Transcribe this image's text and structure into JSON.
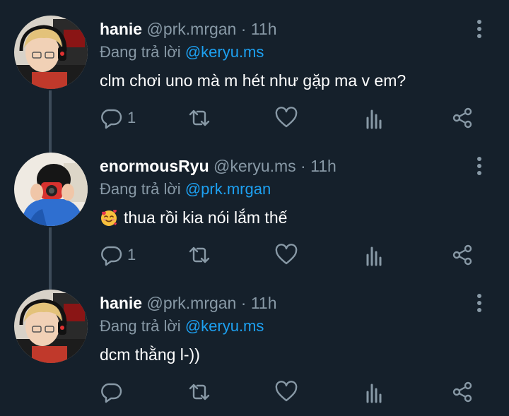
{
  "tweets": [
    {
      "name": "hanie",
      "handle": "@prk.mrgan",
      "dot": " · ",
      "time": "11h",
      "reply_prefix": "Đang trả lời ",
      "reply_to": "@keryu.ms",
      "text": "clm chơi uno mà m hét như gặp ma v em?",
      "reply_count": "1"
    },
    {
      "name": "enormousRyu",
      "handle": "@keryu.ms",
      "dot": " · ",
      "time": "11h",
      "reply_prefix": "Đang trả lời ",
      "reply_to": "@prk.mrgan",
      "text": "thua rồi kia nói lắm thế",
      "reply_count": "1"
    },
    {
      "name": "hanie",
      "handle": "@prk.mrgan",
      "dot": " · ",
      "time": "11h",
      "reply_prefix": "Đang trả lời ",
      "reply_to": "@keryu.ms",
      "text": "dcm thằng l-))",
      "reply_count": ""
    }
  ],
  "icons": {
    "more": "more-vertical-icon",
    "reply": "reply-bubble-icon",
    "retweet": "retweet-icon",
    "like": "heart-icon",
    "analytics": "analytics-icon",
    "share": "share-icon",
    "emoji": "smiling-face-with-hearts-emoji"
  },
  "colors": {
    "background": "#15202b",
    "accent": "#1da1f2",
    "secondary_text": "#8899a6",
    "thread_line": "#3d4b59"
  }
}
